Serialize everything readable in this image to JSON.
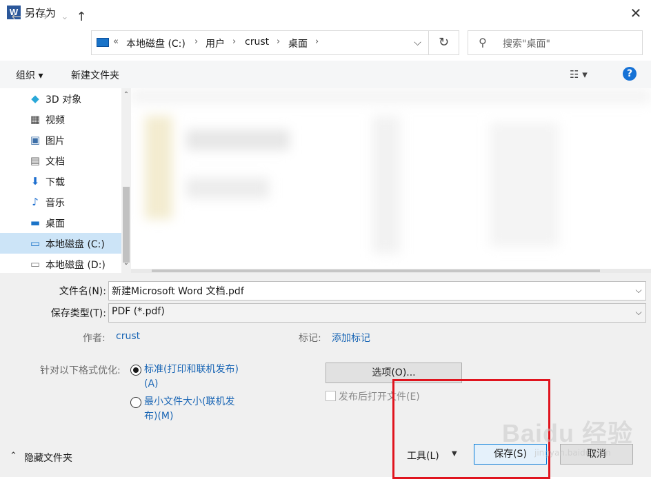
{
  "window": {
    "title": "另存为",
    "app_icon": "W",
    "close_glyph": "✕"
  },
  "nav": {
    "back_glyph": "←",
    "forward_glyph": "→",
    "recent_glyph": "⌄",
    "up_glyph": "↑",
    "breadcrumb": [
      "本地磁盘 (C:)",
      "用户",
      "crust",
      "桌面"
    ],
    "overflow_glyph": "«",
    "sep_glyph": "›",
    "dropdown_glyph": "⌵",
    "refresh_glyph": "↻",
    "search_placeholder": "搜索\"桌面\"",
    "search_glyph": "⚲"
  },
  "toolbar": {
    "organize_label": "组织 ▾",
    "new_folder_label": "新建文件夹",
    "view_glyph": "☷ ▾",
    "help_glyph": "?"
  },
  "sidebar": {
    "items": [
      {
        "label": "3D 对象",
        "icon": "cube-icon",
        "glyph": "◆",
        "color": "#2aa8d8"
      },
      {
        "label": "视频",
        "icon": "film-icon",
        "glyph": "▦",
        "color": "#444444"
      },
      {
        "label": "图片",
        "icon": "picture-icon",
        "glyph": "▣",
        "color": "#3c6fa8"
      },
      {
        "label": "文档",
        "icon": "document-icon",
        "glyph": "▤",
        "color": "#666666"
      },
      {
        "label": "下载",
        "icon": "download-arrow-icon",
        "glyph": "⬇",
        "color": "#1e6fcf"
      },
      {
        "label": "音乐",
        "icon": "music-note-icon",
        "glyph": "♪",
        "color": "#1e6fcf"
      },
      {
        "label": "桌面",
        "icon": "desktop-icon",
        "glyph": "▬",
        "color": "#1a73c8"
      },
      {
        "label": "本地磁盘 (C:)",
        "icon": "windows-drive-icon",
        "glyph": "▭",
        "color": "#1a73c8",
        "selected": true
      },
      {
        "label": "本地磁盘 (D:)",
        "icon": "drive-icon",
        "glyph": "▭",
        "color": "#777777"
      }
    ],
    "scroll_up": "⌃",
    "scroll_down": "⌄"
  },
  "form": {
    "filename_label": "文件名(N):",
    "filename_value": "新建Microsoft Word 文档.pdf",
    "filetype_label": "保存类型(T):",
    "filetype_value": "PDF (*.pdf)",
    "dropdown_glyph": "⌵",
    "author_label": "作者:",
    "author_value": "crust",
    "tags_label": "标记:",
    "tags_value": "添加标记"
  },
  "optimize": {
    "label": "针对以下格式优化:",
    "option1_line1": "标准(打印和联机发布)",
    "option1_line2": "(A)",
    "option2_line1": "最小文件大小(联机发",
    "option2_line2": "布)(M)",
    "options_button": "选项(O)...",
    "open_after_label": "发布后打开文件(E)"
  },
  "footer": {
    "hide_folders_glyph": "⌃",
    "hide_folders_label": "隐藏文件夹",
    "tools_label": "工具(L)",
    "tools_dropdown_glyph": "▼",
    "save_label": "保存(S)",
    "cancel_label": "取消"
  },
  "watermark": {
    "text": "Baidu 经验",
    "url": "jingyan.baidu.com"
  },
  "colors": {
    "accent": "#1a66b5",
    "highlight": "#e0141e",
    "selection": "#cce4f7"
  }
}
